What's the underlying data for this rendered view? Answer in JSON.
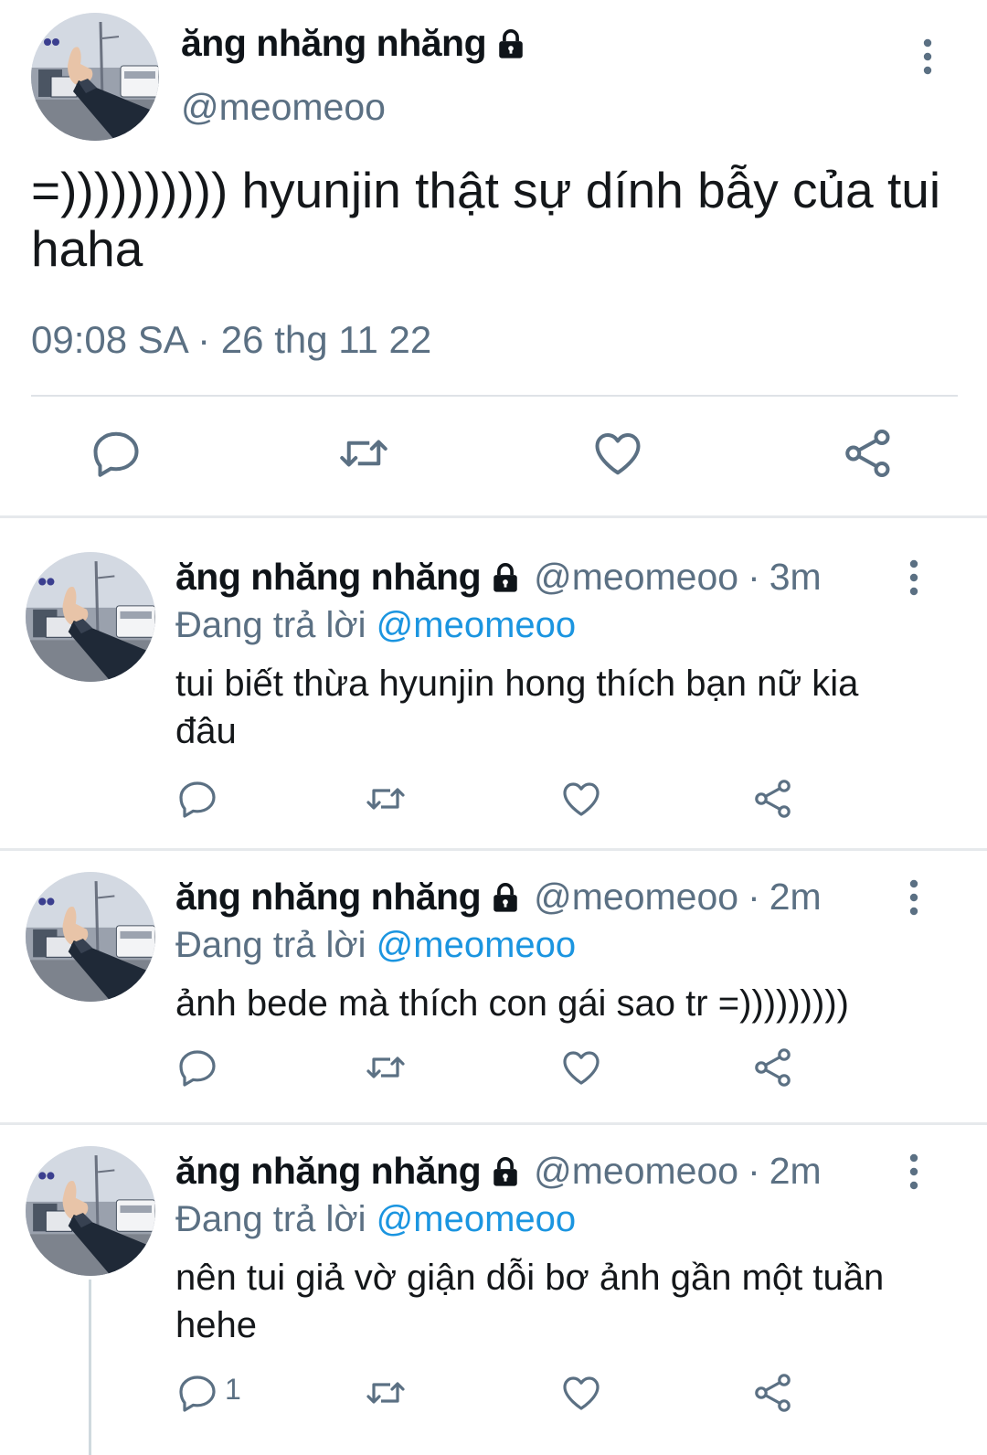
{
  "main_tweet": {
    "display_name": "ăng nhăng nhăng",
    "handle": "@meomeoo",
    "text": "=)))))))))) hyunjin thật sự dính bẫy của tui haha",
    "timestamp": "09:08 SA · 26 thg 11 22",
    "icons": [
      "lock-icon",
      "more-vertical-icon",
      "reply-icon",
      "retweet-icon",
      "like-icon",
      "share-icon"
    ]
  },
  "replies": [
    {
      "display_name": "ăng nhăng nhăng",
      "handle": "@meomeoo",
      "separator": "·",
      "time": "3m",
      "replying_prefix": "Đang trả lời",
      "replying_to": "@meomeoo",
      "text": "tui biết thừa hyunjin hong thích bạn nữ kia đâu",
      "reply_count": ""
    },
    {
      "display_name": "ăng nhăng nhăng",
      "handle": "@meomeoo",
      "separator": "·",
      "time": "2m",
      "replying_prefix": "Đang trả lời",
      "replying_to": "@meomeoo",
      "text": "ảnh bede mà thích con gái sao tr =)))))))))",
      "reply_count": ""
    },
    {
      "display_name": "ăng nhăng nhăng",
      "handle": "@meomeoo",
      "separator": "·",
      "time": "2m",
      "replying_prefix": "Đang trả lời",
      "replying_to": "@meomeoo",
      "text": "nên tui giả vờ giận dỗi bơ ảnh gần một tuần hehe",
      "reply_count": "1"
    }
  ],
  "colors": {
    "text": "#14171a",
    "secondary": "#5b7083",
    "mention": "#1b95e0",
    "divider": "#e6e9ec"
  }
}
